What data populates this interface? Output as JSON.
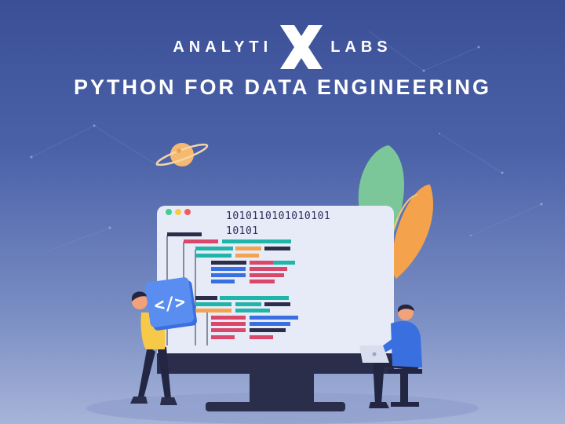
{
  "brand": {
    "left": "ANALYTI",
    "right": "LABS",
    "mark_icon": "x-logo-icon"
  },
  "headline": "PYTHON FOR DATA ENGINEERING",
  "screen": {
    "binary_line1": "1010110101010101",
    "binary_line2": "10101",
    "code_badge_icon": "code-brackets-icon"
  },
  "colors": {
    "background_top": "#3b4f96",
    "background_bottom": "#a7b4d9",
    "accent_blue": "#3a6fe0",
    "code_teal": "#1fb5a8",
    "code_pink": "#d9486b",
    "code_orange": "#f4a24c",
    "leaf_green": "#7bc79a"
  }
}
